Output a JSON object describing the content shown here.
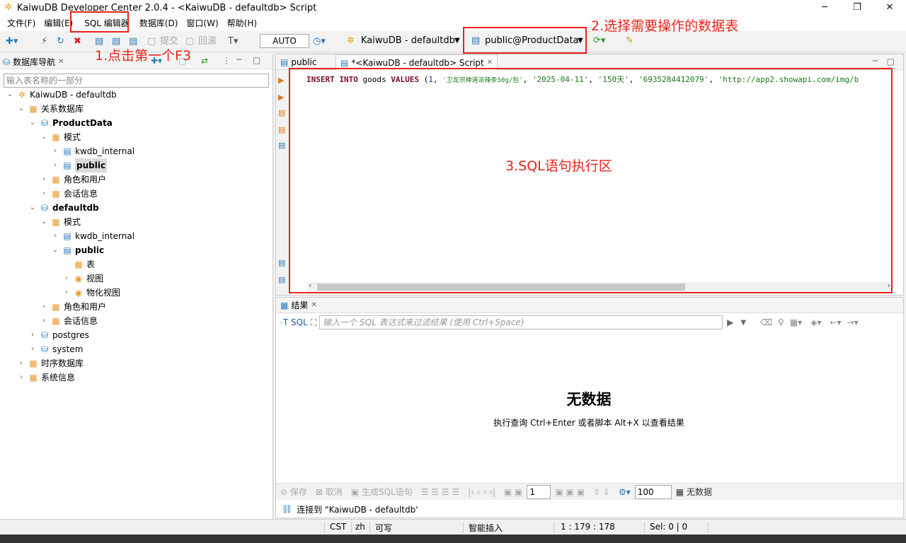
{
  "window": {
    "title": "KaiwuDB Developer Center 2.0.4 - <KaiwuDB - defaultdb> Script",
    "minimize": "─",
    "maximize": "❐",
    "close": "✕"
  },
  "menu": {
    "file": "文件(F)",
    "edit": "编辑(E)",
    "sql_editor": "SQL 编辑器",
    "database": "数据库(D)",
    "window": "窗口(W)",
    "help": "帮助(H)"
  },
  "toolbar": {
    "commit": "提交",
    "rollback": "回滚",
    "auto": "AUTO",
    "connection": "KaiwuDB - defaultdb",
    "schema": "public@ProductData"
  },
  "navigator": {
    "tab_label": "数据库导航",
    "filter_placeholder": "输入表名称的一部分",
    "root": "KaiwuDB - defaultdb",
    "relational": "关系数据库",
    "db1": "ProductData",
    "schemas": "模式",
    "kwdb_internal": "kwdb_internal",
    "public": "public",
    "roles": "角色和用户",
    "sessions": "会话信息",
    "db2": "defaultdb",
    "tables": "表",
    "views": "视图",
    "matviews": "物化视图",
    "postgres": "postgres",
    "system": "system",
    "timeseries": "时序数据库",
    "sysinfo": "系统信息"
  },
  "editor": {
    "tab_public": "public",
    "tab_script": "*<KaiwuDB - defaultdb> Script",
    "code": {
      "kw1": "INSERT INTO",
      "table": " goods ",
      "kw2": "VALUES",
      "open": " (",
      "n1": "1",
      "s1": "'卫龙宗禅道派辣条50g/包'",
      "s2": "'2025-04-11'",
      "s3": "'150天'",
      "s4": "'6935284412079'",
      "s5": "'http://app2.showapi.com/img/b"
    }
  },
  "results": {
    "tab_label": "结果",
    "sql_btn": "SQL",
    "filter_placeholder": "输入一个 SQL 表达式来过滤结果 (使用 Ctrl+Space)",
    "no_data": "无数据",
    "hint": "执行查询 Ctrl+Enter 或者脚本 Alt+X 以查看结果",
    "save": "保存",
    "cancel": "取消",
    "gen_sql": "生成SQL语句",
    "page": "1",
    "limit": "100",
    "no_data_small": "无数据",
    "connected": "连接到 \"KaiwuDB - defaultdb'"
  },
  "statusbar": {
    "tz": "CST",
    "lang": "zh",
    "mode": "可写",
    "insert": "智能插入",
    "pos": "1 : 179 : 178",
    "sel": "Sel: 0 | 0"
  },
  "annotations": {
    "a1": "1.点击第一个F3",
    "a2": "2.选择需要操作的数据表",
    "a3": "3.SQL语句执行区"
  },
  "colors": {
    "annotation": "#e8231c",
    "keyword": "#7a0e28",
    "string": "#1a7a1a"
  }
}
